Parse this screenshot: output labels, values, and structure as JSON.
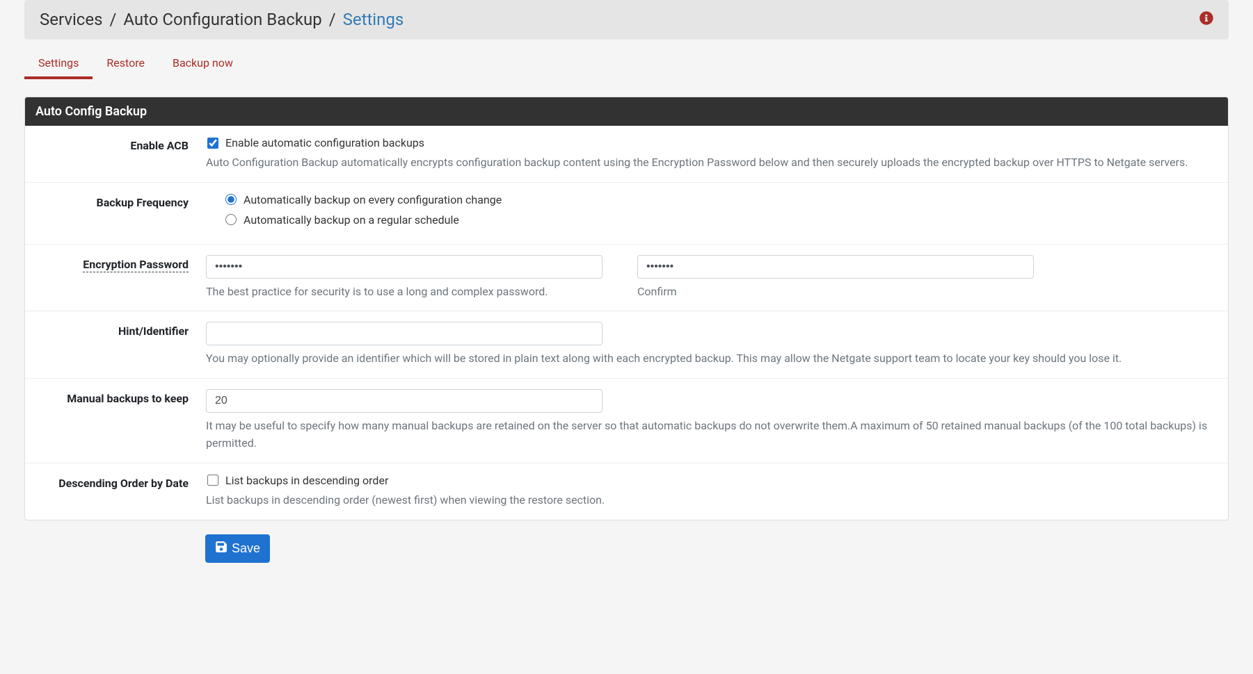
{
  "breadcrumb": {
    "part1": "Services",
    "part2": "Auto Configuration Backup",
    "part3": "Settings"
  },
  "tabs": {
    "settings": "Settings",
    "restore": "Restore",
    "backup_now": "Backup now"
  },
  "panel": {
    "title": "Auto Config Backup"
  },
  "fields": {
    "enable_acb": {
      "label": "Enable ACB",
      "checkbox_label": "Enable automatic configuration backups",
      "checked": true,
      "help": "Auto Configuration Backup automatically encrypts configuration backup content using the Encryption Password below and then securely uploads the encrypted backup over HTTPS to Netgate servers."
    },
    "backup_frequency": {
      "label": "Backup Frequency",
      "option_every": "Automatically backup on every configuration change",
      "option_schedule": "Automatically backup on a regular schedule",
      "selected": "every"
    },
    "encryption_password": {
      "label": "Encryption Password",
      "value": "•••••••",
      "help": "The best practice for security is to use a long and complex password.",
      "confirm_value": "•••••••",
      "confirm_help": "Confirm"
    },
    "hint": {
      "label": "Hint/Identifier",
      "value": "",
      "help": "You may optionally provide an identifier which will be stored in plain text along with each encrypted backup. This may allow the Netgate support team to locate your key should you lose it."
    },
    "manual_backups": {
      "label": "Manual backups to keep",
      "value": "20",
      "help": "It may be useful to specify how many manual backups are retained on the server so that automatic backups do not overwrite them.A maximum of 50 retained manual backups (of the 100 total backups) is permitted."
    },
    "descending": {
      "label": "Descending Order by Date",
      "checkbox_label": "List backups in descending order",
      "checked": false,
      "help": "List backups in descending order (newest first) when viewing the restore section."
    }
  },
  "actions": {
    "save_label": "Save"
  }
}
